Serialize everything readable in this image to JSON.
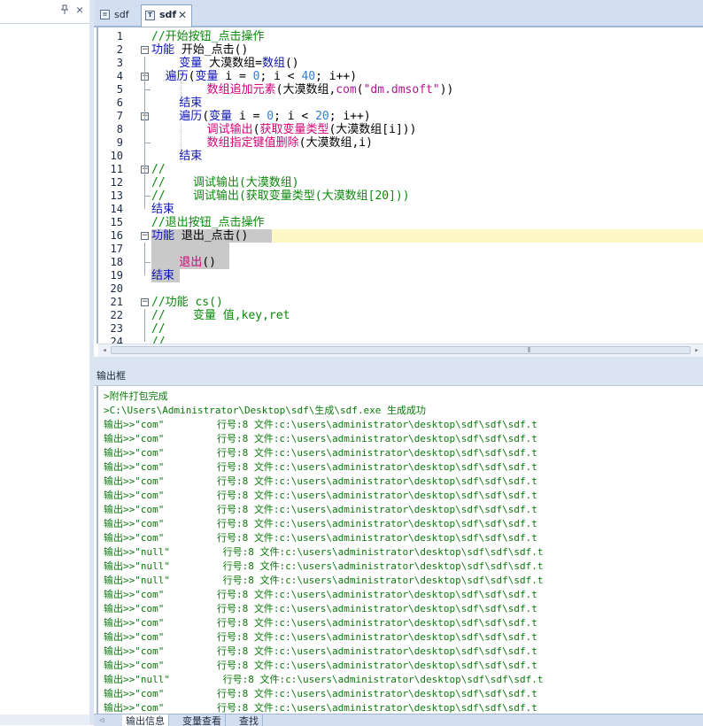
{
  "left_panel": {
    "pin_icon": "pin-icon",
    "close_glyph": "✕"
  },
  "tabs": [
    {
      "label": "sdf",
      "icon": "file-list-icon"
    },
    {
      "label": "sdf",
      "icon": "text-file-icon",
      "close_glyph": "✕"
    }
  ],
  "editor": {
    "line_numbers": [
      "1",
      "2",
      "3",
      "4",
      "5",
      "6",
      "7",
      "8",
      "9",
      "10",
      "11",
      "12",
      "13",
      "14",
      "15",
      "16",
      "17",
      "18",
      "19",
      "20",
      "21",
      "22",
      "23",
      "24"
    ],
    "lines": [
      [
        {
          "t": "//开始按钮_点击操作",
          "c": "comment"
        }
      ],
      [
        {
          "t": "功能",
          "c": "kw"
        },
        {
          "t": " 开始_点击()",
          "c": "plain"
        }
      ],
      [
        {
          "t": "    变量",
          "c": "kw"
        },
        {
          "t": " 大漠数组=",
          "c": "plain"
        },
        {
          "t": "数组",
          "c": "kw"
        },
        {
          "t": "()",
          "c": "plain"
        }
      ],
      [
        {
          "t": "  遍历",
          "c": "kw"
        },
        {
          "t": "(",
          "c": "plain"
        },
        {
          "t": "变量",
          "c": "kw"
        },
        {
          "t": " i = ",
          "c": "plain"
        },
        {
          "t": "0",
          "c": "num"
        },
        {
          "t": "; i < ",
          "c": "plain"
        },
        {
          "t": "40",
          "c": "num"
        },
        {
          "t": "; i++)",
          "c": "plain"
        }
      ],
      [
        {
          "t": "        数组追加元素",
          "c": "fn"
        },
        {
          "t": "(大漠数组,",
          "c": "plain"
        },
        {
          "t": "com",
          "c": "str"
        },
        {
          "t": "(",
          "c": "plain"
        },
        {
          "t": "\"dm.dmsoft\"",
          "c": "str"
        },
        {
          "t": "))",
          "c": "plain"
        }
      ],
      [
        {
          "t": "    结束",
          "c": "kw"
        }
      ],
      [
        {
          "t": "    遍历",
          "c": "kw"
        },
        {
          "t": "(",
          "c": "plain"
        },
        {
          "t": "变量",
          "c": "kw"
        },
        {
          "t": " i = ",
          "c": "plain"
        },
        {
          "t": "0",
          "c": "num"
        },
        {
          "t": "; i < ",
          "c": "plain"
        },
        {
          "t": "20",
          "c": "num"
        },
        {
          "t": "; i++)",
          "c": "plain"
        }
      ],
      [
        {
          "t": "        调试输出",
          "c": "fn"
        },
        {
          "t": "(",
          "c": "plain"
        },
        {
          "t": "获取变量类型",
          "c": "fn"
        },
        {
          "t": "(大漠数组[i]))",
          "c": "plain"
        }
      ],
      [
        {
          "t": "        数组指定键值删除",
          "c": "fn"
        },
        {
          "t": "(大漠数组,i)",
          "c": "plain"
        }
      ],
      [
        {
          "t": "    结束",
          "c": "kw"
        }
      ],
      [
        {
          "t": "//",
          "c": "comment"
        }
      ],
      [
        {
          "t": "//    调试输出(大漠数组)",
          "c": "comment"
        }
      ],
      [
        {
          "t": "//    调试输出(获取变量类型(大漠数组[20]))",
          "c": "comment"
        }
      ],
      [
        {
          "t": "结束",
          "c": "kw"
        }
      ],
      [
        {
          "t": "//退出按钮_点击操作",
          "c": "comment"
        }
      ],
      [
        {
          "t": "功能",
          "c": "kw"
        },
        {
          "t": " 退出_点击()",
          "c": "plain"
        }
      ],
      [],
      [
        {
          "t": "    退出",
          "c": "fn"
        },
        {
          "t": "()",
          "c": "plain"
        }
      ],
      [
        {
          "t": "结束",
          "c": "kw"
        }
      ],
      [],
      [
        {
          "t": "//功能 cs()",
          "c": "comment"
        }
      ],
      [
        {
          "t": "//    变量 值,key,ret",
          "c": "comment"
        }
      ],
      [
        {
          "t": "//",
          "c": "comment"
        }
      ],
      [
        {
          "t": "//",
          "c": "comment"
        }
      ]
    ]
  },
  "hscroll": {
    "left_arrow": "◂",
    "right_arrow": "▸",
    "grip": "⦀"
  },
  "output": {
    "title": "输出框",
    "lines": [
      ">附件打包完成",
      ">C:\\Users\\Administrator\\Desktop\\sdf\\生成\\sdf.exe 生成成功",
      "输出>>\"com\"         行号:8 文件:c:\\users\\administrator\\desktop\\sdf\\sdf\\sdf.t",
      "输出>>\"com\"         行号:8 文件:c:\\users\\administrator\\desktop\\sdf\\sdf\\sdf.t",
      "输出>>\"com\"         行号:8 文件:c:\\users\\administrator\\desktop\\sdf\\sdf\\sdf.t",
      "输出>>\"com\"         行号:8 文件:c:\\users\\administrator\\desktop\\sdf\\sdf\\sdf.t",
      "输出>>\"com\"         行号:8 文件:c:\\users\\administrator\\desktop\\sdf\\sdf\\sdf.t",
      "输出>>\"com\"         行号:8 文件:c:\\users\\administrator\\desktop\\sdf\\sdf\\sdf.t",
      "输出>>\"com\"         行号:8 文件:c:\\users\\administrator\\desktop\\sdf\\sdf\\sdf.t",
      "输出>>\"com\"         行号:8 文件:c:\\users\\administrator\\desktop\\sdf\\sdf\\sdf.t",
      "输出>>\"com\"         行号:8 文件:c:\\users\\administrator\\desktop\\sdf\\sdf\\sdf.t",
      "输出>>\"null\"         行号:8 文件:c:\\users\\administrator\\desktop\\sdf\\sdf\\sdf.t",
      "输出>>\"null\"         行号:8 文件:c:\\users\\administrator\\desktop\\sdf\\sdf\\sdf.t",
      "输出>>\"null\"         行号:8 文件:c:\\users\\administrator\\desktop\\sdf\\sdf\\sdf.t",
      "输出>>\"com\"         行号:8 文件:c:\\users\\administrator\\desktop\\sdf\\sdf\\sdf.t",
      "输出>>\"com\"         行号:8 文件:c:\\users\\administrator\\desktop\\sdf\\sdf\\sdf.t",
      "输出>>\"com\"         行号:8 文件:c:\\users\\administrator\\desktop\\sdf\\sdf\\sdf.t",
      "输出>>\"com\"         行号:8 文件:c:\\users\\administrator\\desktop\\sdf\\sdf\\sdf.t",
      "输出>>\"com\"         行号:8 文件:c:\\users\\administrator\\desktop\\sdf\\sdf\\sdf.t",
      "输出>>\"com\"         行号:8 文件:c:\\users\\administrator\\desktop\\sdf\\sdf\\sdf.t",
      "输出>>\"null\"         行号:8 文件:c:\\users\\administrator\\desktop\\sdf\\sdf\\sdf.t",
      "输出>>\"com\"         行号:8 文件:c:\\users\\administrator\\desktop\\sdf\\sdf\\sdf.t",
      "输出>>\"com\"         行号:8 文件:c:\\users\\administrator\\desktop\\sdf\\sdf\\sdf.t"
    ]
  },
  "bottom_tabs": [
    {
      "label": "输出信息"
    },
    {
      "label": "变量查看"
    },
    {
      "label": "查找"
    }
  ],
  "colors": {
    "comment": "#0a8a0a",
    "keyword": "#0d14b8",
    "function": "#d90078",
    "number": "#2c7fd8",
    "string": "#b4168f",
    "output_text": "#0a7a0a",
    "current_line": "#fdf8c5",
    "selection": "#c9c9c9",
    "chrome": "#d3def0"
  }
}
